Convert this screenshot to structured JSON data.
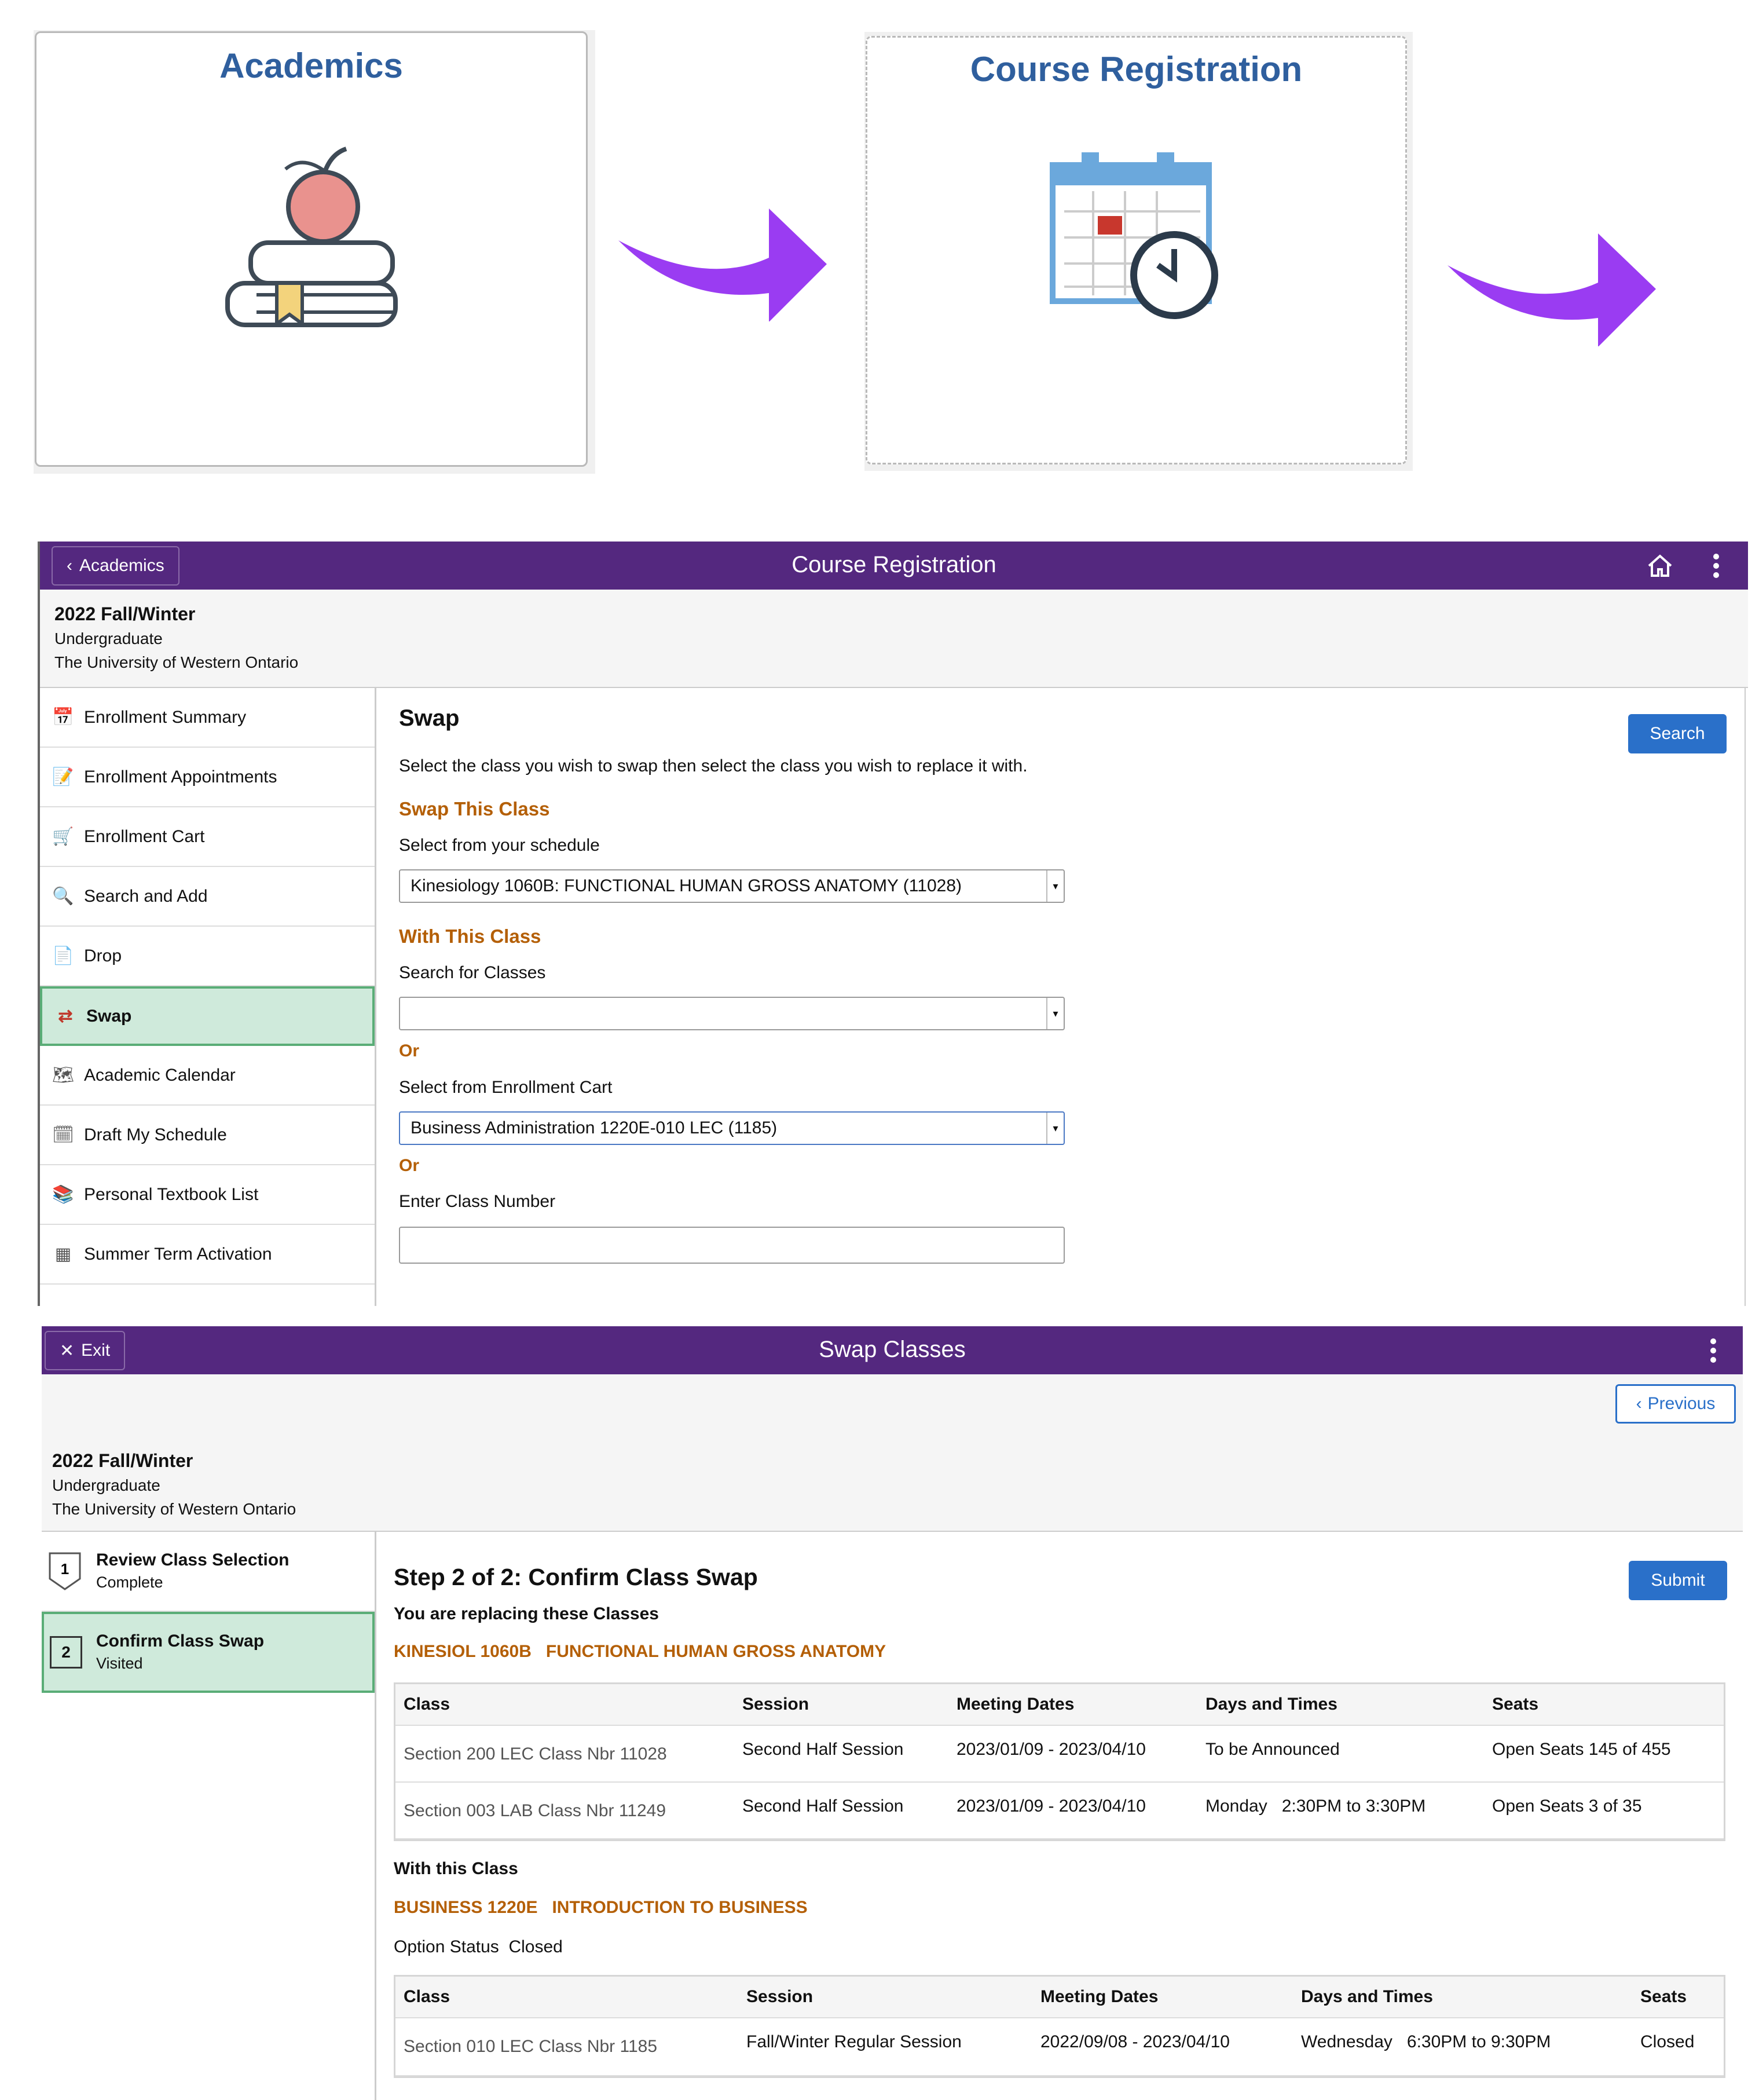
{
  "tiles": {
    "academics": {
      "title": "Academics"
    },
    "course_registration": {
      "title": "Course Registration"
    }
  },
  "arrow_color": "#9a3cf2",
  "course_reg": {
    "back_label": "Academics",
    "title": "Course Registration",
    "term": {
      "name": "2022 Fall/Winter",
      "career": "Undergraduate",
      "institution": "The University of Western Ontario"
    },
    "nav": [
      {
        "label": "Enrollment Summary",
        "icon": "calendar-icon"
      },
      {
        "label": "Enrollment Appointments",
        "icon": "appointment-icon"
      },
      {
        "label": "Enrollment Cart",
        "icon": "cart-icon"
      },
      {
        "label": "Search and Add",
        "icon": "search-icon"
      },
      {
        "label": "Drop",
        "icon": "drop-icon"
      },
      {
        "label": "Swap",
        "icon": "swap-icon",
        "selected": true
      },
      {
        "label": "Academic Calendar",
        "icon": "academic-calendar-icon"
      },
      {
        "label": "Draft My Schedule",
        "icon": "schedule-icon"
      },
      {
        "label": "Personal Textbook List",
        "icon": "books-icon"
      },
      {
        "label": "Summer Term Activation",
        "icon": "term-calendar-icon"
      }
    ],
    "swap": {
      "heading": "Swap",
      "search_button": "Search",
      "instructions": "Select the class you wish to swap then select the class you wish to replace it with.",
      "swap_this_heading": "Swap This Class",
      "select_schedule_label": "Select from your schedule",
      "schedule_value": "Kinesiology 1060B: FUNCTIONAL HUMAN GROSS ANATOMY (11028)",
      "with_this_heading": "With This Class",
      "search_classes_label": "Search for Classes",
      "search_classes_value": "",
      "or1": "Or",
      "select_cart_label": "Select from Enrollment Cart",
      "cart_value": "Business Administration 1220E-010 LEC (1185)",
      "or2": "Or",
      "class_number_label": "Enter Class Number",
      "class_number_value": ""
    }
  },
  "swap_classes": {
    "exit_label": "Exit",
    "title": "Swap Classes",
    "previous_label": "Previous",
    "term": {
      "name": "2022 Fall/Winter",
      "career": "Undergraduate",
      "institution": "The University of Western Ontario"
    },
    "steps": [
      {
        "num": "1",
        "title": "Review Class Selection",
        "status": "Complete"
      },
      {
        "num": "2",
        "title": "Confirm Class Swap",
        "status": "Visited",
        "selected": true
      }
    ],
    "heading": "Step 2 of 2: Confirm Class Swap",
    "submit_label": "Submit",
    "replacing_label": "You are replacing these Classes",
    "replacing_course": "KINESIOL 1060B   FUNCTIONAL HUMAN GROSS ANATOMY",
    "table1": {
      "columns": [
        "Class",
        "Session",
        "Meeting Dates",
        "Days and Times",
        "Seats"
      ],
      "rows": [
        [
          "Section 200 LEC Class Nbr 11028",
          "Second Half Session",
          "2023/01/09 - 2023/04/10",
          "To be Announced",
          "Open Seats 145 of 455"
        ],
        [
          "Section 003 LAB Class Nbr 11249",
          "Second Half Session",
          "2023/01/09 - 2023/04/10",
          "Monday   2:30PM to 3:30PM",
          "Open Seats 3 of 35"
        ]
      ]
    },
    "with_label": "With this Class",
    "with_course": "BUSINESS 1220E   INTRODUCTION TO BUSINESS",
    "option_status_label": "Option Status",
    "option_status_value": "Closed",
    "table2": {
      "columns": [
        "Class",
        "Session",
        "Meeting Dates",
        "Days and Times",
        "Seats"
      ],
      "rows": [
        [
          "Section 010 LEC Class Nbr 1185",
          "Fall/Winter Regular Session",
          "2022/09/08 - 2023/04/10",
          "Wednesday   6:30PM to 9:30PM",
          "Closed"
        ]
      ]
    }
  }
}
